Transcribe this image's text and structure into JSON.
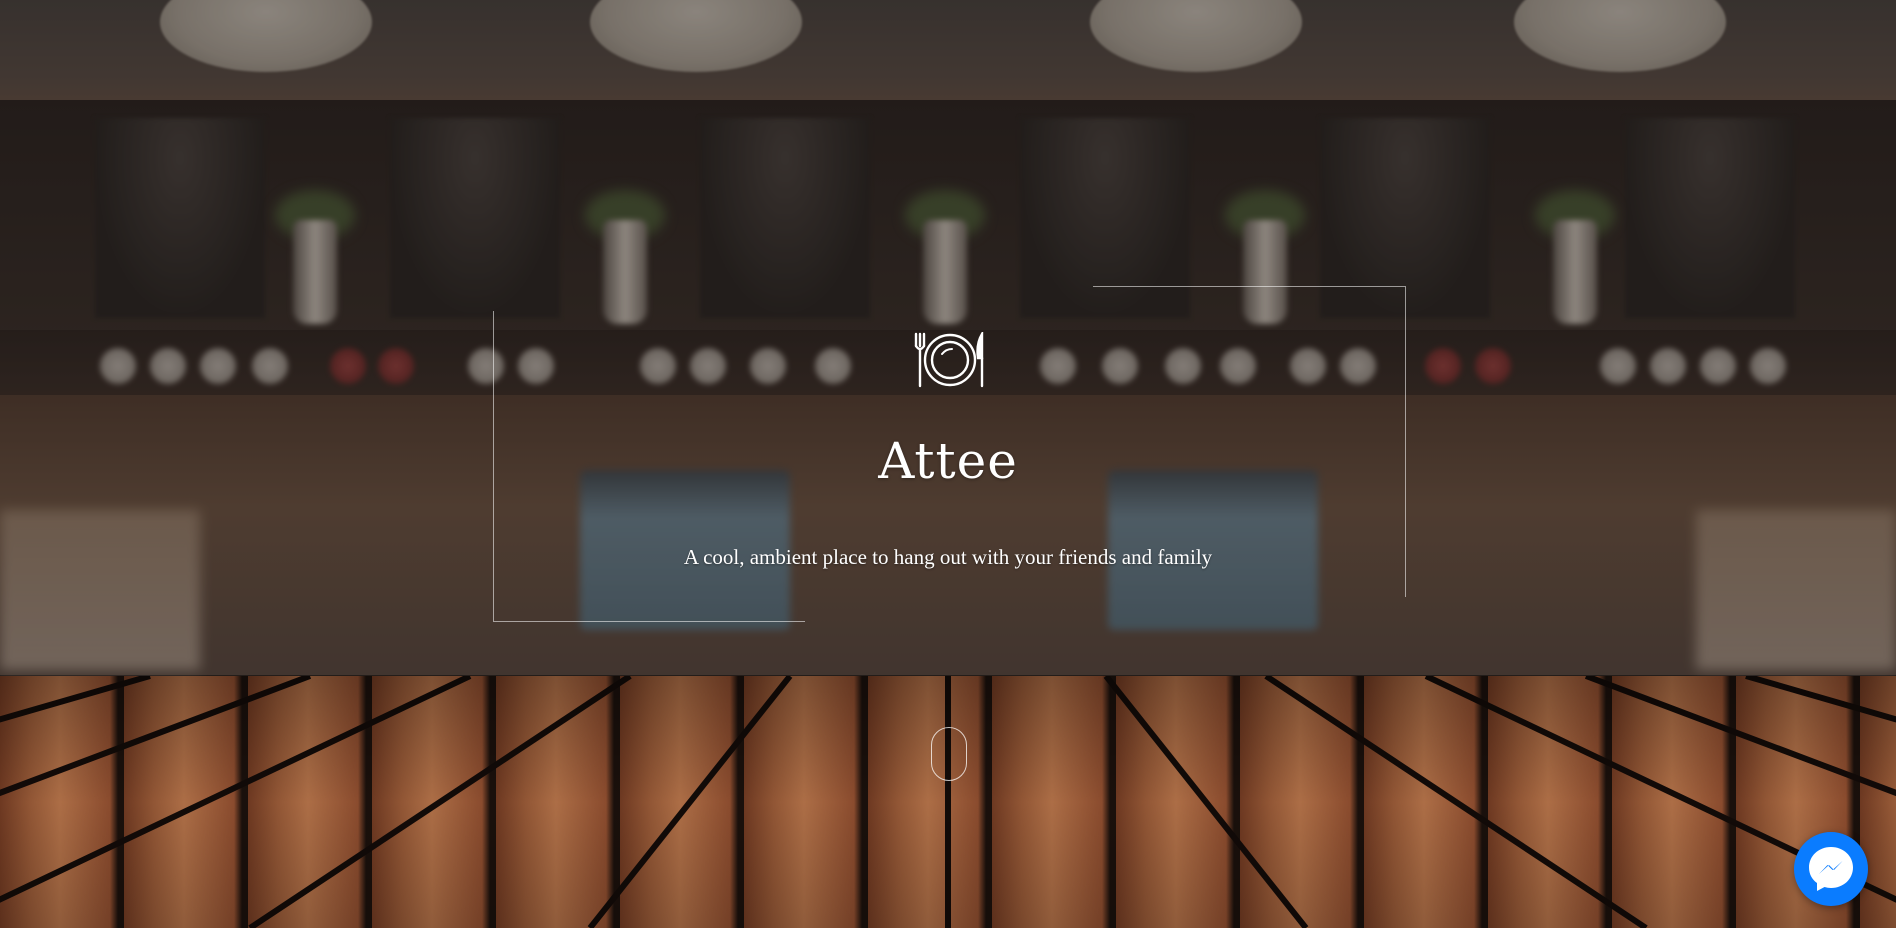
{
  "hero": {
    "title": "Attee",
    "tagline": "A cool, ambient place to hang out with your friends and family",
    "logo_icon": "plate-fork-knife-icon"
  },
  "scroll_indicator": {
    "icon": "mouse-scroll-icon"
  },
  "chat_widget": {
    "icon": "messenger-icon",
    "color": "#0a7cff"
  },
  "colors": {
    "text": "#ffffff",
    "frame_border": "rgba(255,255,255,0.55)"
  }
}
